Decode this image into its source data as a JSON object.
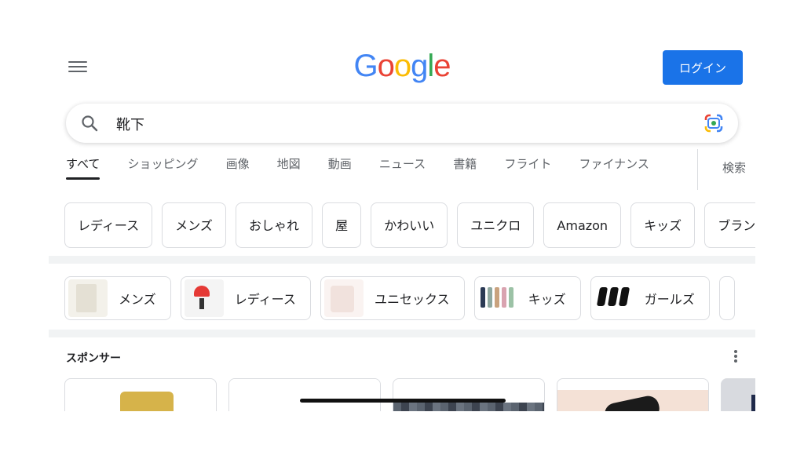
{
  "header": {
    "logo_letters": [
      {
        "char": "G",
        "color": "#4285F4"
      },
      {
        "char": "o",
        "color": "#EA4335"
      },
      {
        "char": "o",
        "color": "#FBBC05"
      },
      {
        "char": "g",
        "color": "#4285F4"
      },
      {
        "char": "l",
        "color": "#34A853"
      },
      {
        "char": "e",
        "color": "#EA4335"
      }
    ],
    "login_label": "ログイン",
    "accent_color": "#1a73e8"
  },
  "search": {
    "query": "靴下",
    "left_icon": "search-icon",
    "right_icon": "google-lens-icon"
  },
  "tabs": {
    "items": [
      {
        "label": "すべて",
        "active": true
      },
      {
        "label": "ショッピング"
      },
      {
        "label": "画像"
      },
      {
        "label": "地図"
      },
      {
        "label": "動画"
      },
      {
        "label": "ニュース"
      },
      {
        "label": "書籍"
      },
      {
        "label": "フライト"
      },
      {
        "label": "ファイナンス"
      }
    ],
    "more_label": "検索"
  },
  "chips": [
    "レディース",
    "メンズ",
    "おしゃれ",
    "屋",
    "かわいい",
    "ユニクロ",
    "Amazon",
    "キッズ",
    "ブランド"
  ],
  "image_chips": [
    {
      "label": "メンズ"
    },
    {
      "label": "レディース"
    },
    {
      "label": "ユニセックス"
    },
    {
      "label": "キッズ"
    },
    {
      "label": "ガールズ"
    }
  ],
  "sponsored": {
    "title": "スポンサー",
    "menu_icon": "more-vert-icon"
  }
}
